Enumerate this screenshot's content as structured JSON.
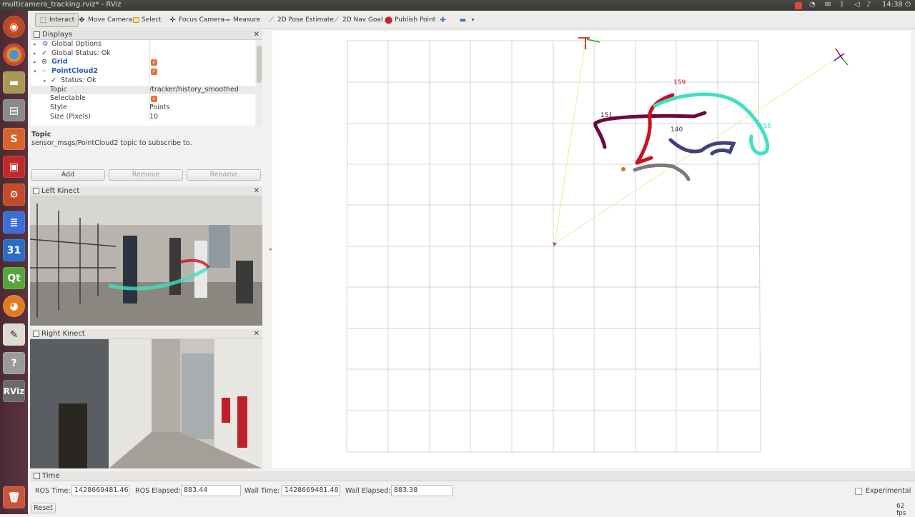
{
  "window": {
    "title": "multicamera_tracking.rviz* - RViz",
    "clock": "14:38"
  },
  "toolbar": {
    "interact": "Interact",
    "move_camera": "Move Camera",
    "select": "Select",
    "focus_camera": "Focus Camera",
    "measure": "Measure",
    "pose_estimate": "2D Pose Estimate",
    "nav_goal": "2D Nav Goal",
    "publish_point": "Publish Point"
  },
  "displays": {
    "title": "Displays",
    "rows": {
      "global_options": "Global Options",
      "global_status": "Global Status: Ok",
      "grid": "Grid",
      "pointcloud2": "PointCloud2",
      "status": "Status: Ok",
      "topic_key": "Topic",
      "topic_val": "/tracker/history_smoothed",
      "selectable_key": "Selectable",
      "style_key": "Style",
      "style_val": "Points",
      "size_key": "Size (Pixels)",
      "size_val": "10"
    },
    "desc_title": "Topic",
    "desc_text": "sensor_msgs/PointCloud2 topic to subscribe to.",
    "add": "Add",
    "remove": "Remove",
    "rename": "Rename"
  },
  "cameras": {
    "left": "Left Kinect",
    "right": "Right Kinect"
  },
  "tracks": {
    "t159": "159",
    "t151": "151",
    "t140": "140",
    "t156": "156"
  },
  "time": {
    "title": "Time",
    "ros_time_label": "ROS Time:",
    "ros_time": "1428669481.46",
    "ros_elapsed_label": "ROS Elapsed:",
    "ros_elapsed": "883.44",
    "wall_time_label": "Wall Time:",
    "wall_time": "1428669481.48",
    "wall_elapsed_label": "Wall Elapsed:",
    "wall_elapsed": "883.38",
    "experimental": "Experimental",
    "reset": "Reset",
    "fps": "62 fps"
  },
  "launcher": {
    "calendar_day": "31",
    "qt": "Qt",
    "rviz": "RViz"
  },
  "colors": {
    "launcher": "#5a3440",
    "accent": "#e4733a",
    "track_red": "#cc1020",
    "track_cyan": "#40e0c0",
    "track_purple": "#6a0a40",
    "track_blue": "#404080"
  }
}
